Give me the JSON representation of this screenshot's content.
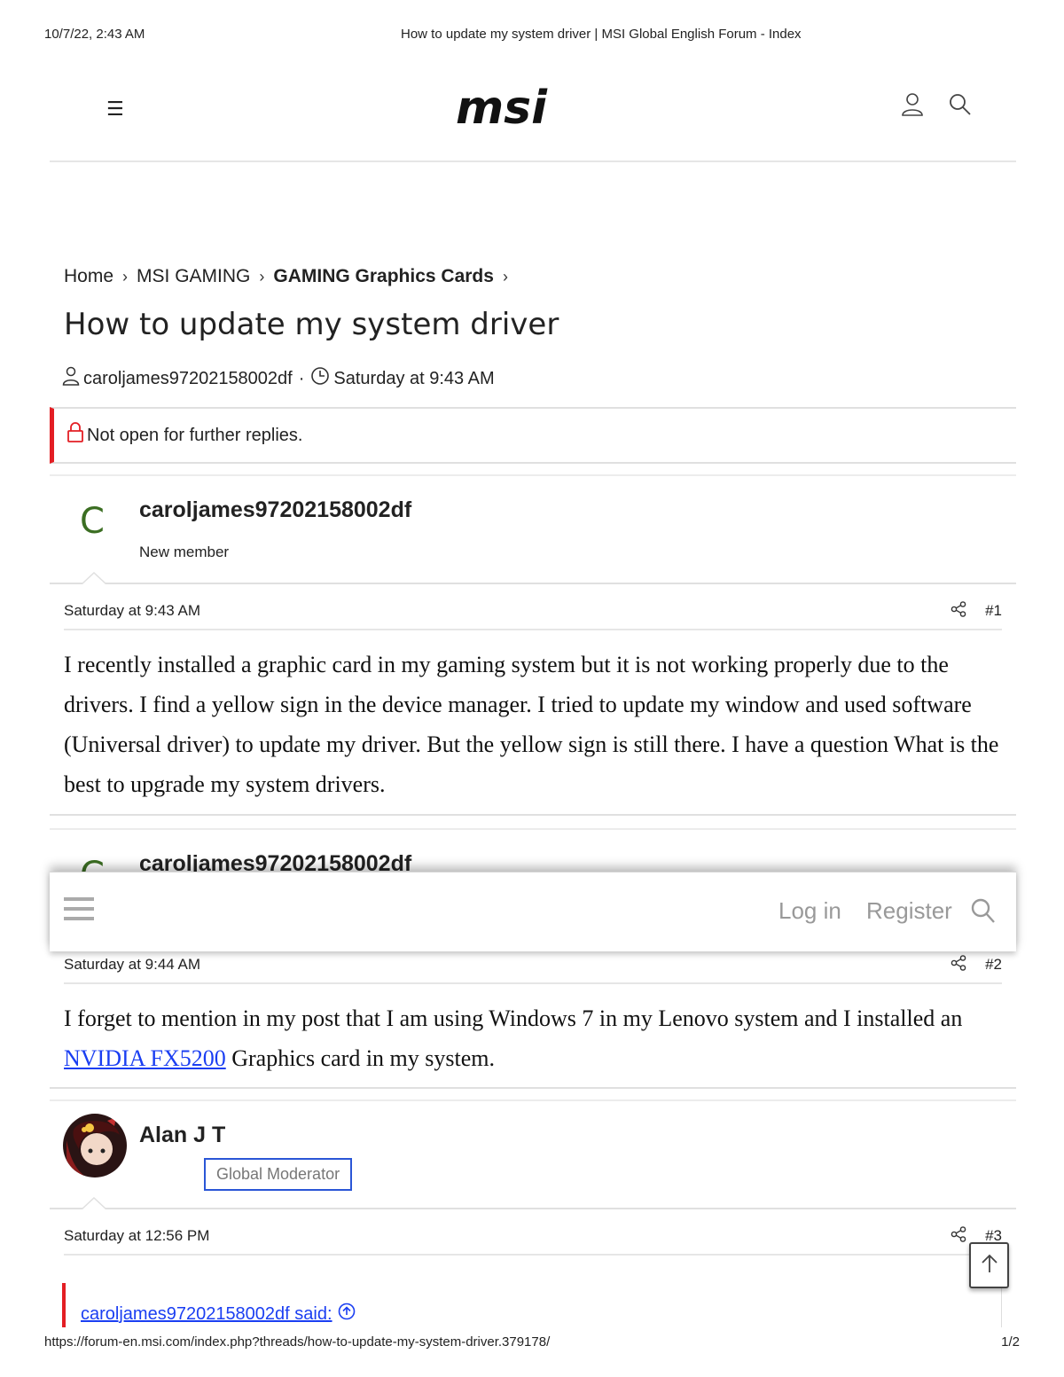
{
  "print": {
    "date": "10/7/22, 2:43 AM",
    "title": "How to update my system driver | MSI Global English Forum - Index",
    "url": "https://forum-en.msi.com/index.php?threads/how-to-update-my-system-driver.379178/",
    "pages": "1/2"
  },
  "header": {
    "logo_text": "msi",
    "menu_glyph": "☰"
  },
  "breadcrumb": [
    {
      "label": "Home"
    },
    {
      "label": "MSI GAMING"
    },
    {
      "label": "GAMING Graphics Cards"
    }
  ],
  "thread": {
    "title": "How to update my system driver",
    "author": "caroljames97202158002df",
    "separator": "·",
    "date": "Saturday at 9:43 AM",
    "notice": "Not open for further replies."
  },
  "posts": [
    {
      "avatar_letter": "C",
      "username": "caroljames97202158002df",
      "role": "New member",
      "time": "Saturday at 9:43 AM",
      "number": "#1",
      "body": "I recently installed a graphic card in my gaming system but it is not working properly due to the drivers. I find a yellow sign in the device manager. I tried to update my window and used software (Universal driver) to update my driver. But the yellow sign is still there. I have a question What is the best to upgrade my system drivers."
    },
    {
      "avatar_letter": "C",
      "username": "caroljames97202158002df",
      "time": "Saturday at 9:44 AM",
      "number": "#2",
      "body_before": "I forget to mention in my post that I am using Windows 7 in my Lenovo system and I installed an ",
      "link_text": "NVIDIA FX5200",
      "body_after": " Graphics card in my system."
    },
    {
      "username": "Alan J T",
      "role": "Global Moderator",
      "time": "Saturday at 12:56 PM",
      "number": "#3",
      "quote_label": "caroljames97202158002df said:"
    }
  ],
  "sticky_bar": {
    "login": "Log in",
    "register": "Register"
  },
  "colors": {
    "accent_red": "#e31e24",
    "link_blue": "#1a3ef2",
    "avatar_green": "#3b6e22",
    "badge_border": "#2a56d6"
  },
  "icons": [
    "menu-icon",
    "user-icon",
    "search-icon",
    "chevron-right-icon",
    "clock-icon",
    "lock-icon",
    "share-icon",
    "arrow-up-icon",
    "arrow-circle-up-icon"
  ]
}
